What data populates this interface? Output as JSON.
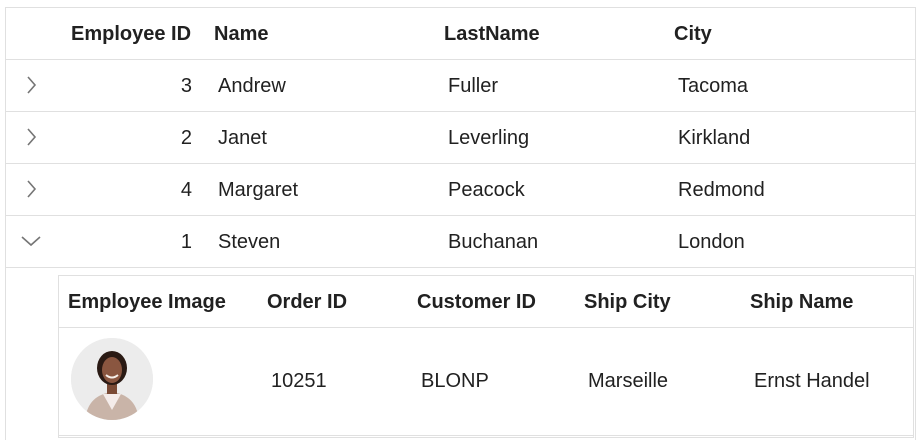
{
  "master": {
    "headers": {
      "employee_id": "Employee ID",
      "name": "Name",
      "last_name": "LastName",
      "city": "City"
    },
    "rows": [
      {
        "employee_id": "3",
        "name": "Andrew",
        "last_name": "Fuller",
        "city": "Tacoma",
        "toggle": "chevron-right-icon"
      },
      {
        "employee_id": "2",
        "name": "Janet",
        "last_name": "Leverling",
        "city": "Kirkland",
        "toggle": "chevron-right-icon"
      },
      {
        "employee_id": "4",
        "name": "Margaret",
        "last_name": "Peacock",
        "city": "Redmond",
        "toggle": "chevron-right-icon"
      },
      {
        "employee_id": "1",
        "name": "Steven",
        "last_name": "Buchanan",
        "city": "London",
        "toggle": "chevron-down-icon"
      }
    ]
  },
  "detail": {
    "headers": {
      "employee_image": "Employee Image",
      "order_id": "Order ID",
      "customer_id": "Customer ID",
      "ship_city": "Ship City",
      "ship_name": "Ship Name"
    },
    "rows": [
      {
        "order_id": "10251",
        "customer_id": "BLONP",
        "ship_city": "Marseille",
        "ship_name": "Ernst Handel"
      }
    ]
  },
  "colors": {
    "border": "#e0e0e0",
    "text": "#212121",
    "icon": "#757575"
  }
}
